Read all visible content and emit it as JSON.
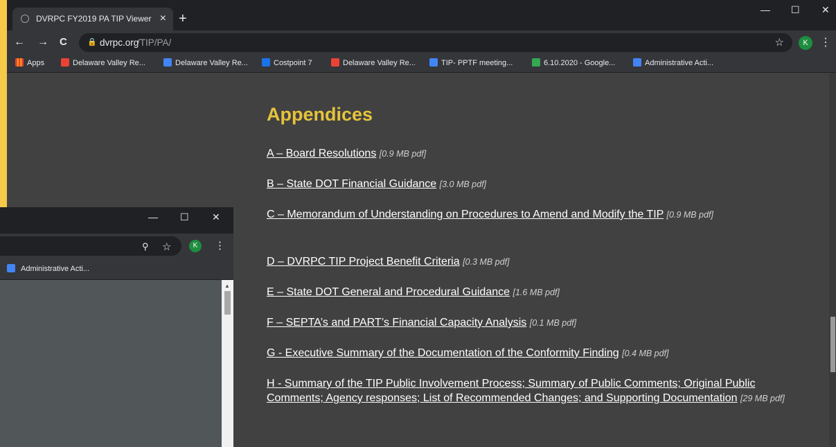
{
  "browser": {
    "tab_title": "DVRPC FY2019 PA TIP Viewer",
    "tab_close": "×",
    "new_tab": "+",
    "minimize": "—",
    "maximize": "☐",
    "close": "✕",
    "back": "←",
    "forward": "→",
    "reload": "C",
    "url_host": "dvrpc.org",
    "url_path": "/TIP/PA/",
    "bookmark_star": "☆",
    "avatar_letter": "K",
    "menu": "⋮"
  },
  "bookmarks": [
    {
      "label": "Apps",
      "icon": "apps-grid-icon",
      "color": "#ea4335"
    },
    {
      "label": "Delaware Valley Re...",
      "icon": "gmail-icon",
      "color": "#ea4335"
    },
    {
      "label": "Delaware Valley Re...",
      "icon": "calendar-icon",
      "color": "#4285f4"
    },
    {
      "label": "Costpoint 7",
      "icon": "costpoint-icon",
      "color": "#1a73e8"
    },
    {
      "label": "Delaware Valley Re...",
      "icon": "gmail-icon",
      "color": "#ea4335"
    },
    {
      "label": "TIP- PPTF meeting...",
      "icon": "docs-icon",
      "color": "#4285f4"
    },
    {
      "label": "6.10.2020 - Google...",
      "icon": "drive-icon",
      "color": "#34a853"
    },
    {
      "label": "Administrative Acti...",
      "icon": "docs-icon",
      "color": "#4285f4"
    }
  ],
  "page": {
    "heading": "Appendices",
    "appendices": [
      {
        "label": "A – Board Resolutions",
        "size": "[0.9 MB pdf]"
      },
      {
        "label": "B – State DOT Financial Guidance",
        "size": "[3.0 MB pdf]"
      },
      {
        "label": "C – Memorandum of Understanding on Procedures to Amend and Modify the TIP",
        "size": "[0.9 MB pdf]"
      },
      {
        "label": "D – DVRPC TIP Project Benefit Criteria",
        "size": "[0.3 MB pdf]"
      },
      {
        "label": "E – State DOT General and Procedural Guidance",
        "size": "[1.6 MB pdf]"
      },
      {
        "label": "F – SEPTA’s and PART’s Financial Capacity Analysis",
        "size": "[0.1 MB pdf]"
      },
      {
        "label": "G - Executive Summary of the Documentation of the Conformity Finding",
        "size": "[0.4 MB pdf]"
      },
      {
        "label": "H - Summary of the TIP Public Involvement Process; Summary of Public Comments; Original Public Comments; Agency responses; List of Recommended Changes; and Supporting Documentation",
        "size": "[29 MB pdf]"
      }
    ]
  },
  "popup": {
    "minimize": "—",
    "maximize": "☐",
    "close": "✕",
    "zoom": "⚲",
    "star": "☆",
    "avatar_letter": "K",
    "menu": "⋮",
    "bookmark": "Administrative Acti...",
    "scroll_up": "▲"
  }
}
